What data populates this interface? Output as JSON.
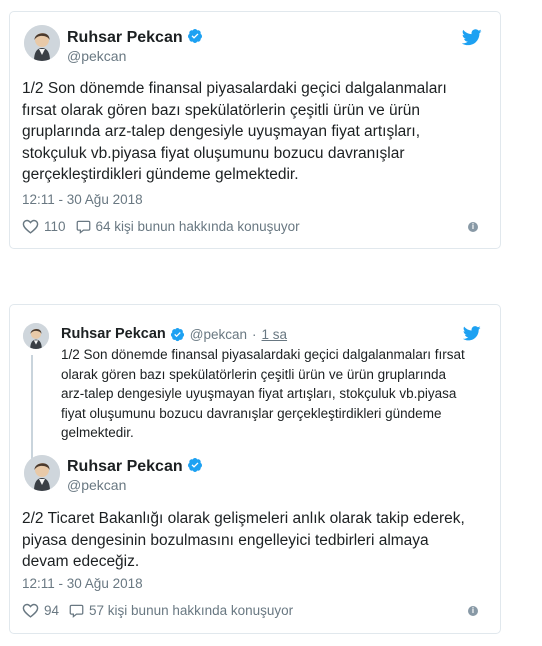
{
  "tweet1": {
    "author_name": "Ruhsar Pekcan",
    "handle": "@pekcan",
    "text": "1/2 Son dönemde finansal piyasalardaki geçici dalgalanmaları\nfırsat olarak gören bazı spekülatörlerin çeşitli ürün ve ürün\ngruplarında  arz-talep dengesiyle uyuşmayan  fiyat artışları,\nstokçuluk vb.piyasa fiyat oluşumunu bozucu davranışlar\ngerçekleştirdikleri gündeme gelmektedir.",
    "timestamp": "12:11 - 30 Ağu 2018",
    "likes": "110",
    "conversation": "64 kişi bunun hakkında konuşuyor"
  },
  "tweet2": {
    "quoted": {
      "author_name": "Ruhsar Pekcan",
      "handle": "@pekcan",
      "separator": "·",
      "time_ago": "1 sa",
      "text": "1/2 Son dönemde finansal piyasalardaki geçici dalgalanmaları fırsat\nolarak gören bazı spekülatörlerin çeşitli ürün ve ürün gruplarında\narz-talep dengesiyle uyuşmayan  fiyat artışları, stokçuluk vb.piyasa\nfiyat oluşumunu bozucu davranışlar gerçekleştirdikleri gündeme\ngelmektedir."
    },
    "author_name": "Ruhsar Pekcan",
    "handle": "@pekcan",
    "text": "2/2 Ticaret Bakanlığı olarak gelişmeleri anlık olarak takip ederek,\npiyasa dengesinin bozulmasını engelleyici tedbirleri almaya\ndevam edeceğiz.",
    "timestamp": "12:11 - 30 Ağu 2018",
    "likes": "94",
    "conversation": "57 kişi bunun hakkında konuşuyor"
  },
  "colors": {
    "twitter_blue": "#1da1f2",
    "verified_blue": "#1da1f2",
    "secondary_text": "#697882",
    "border": "#e1e8ed"
  },
  "icons": {
    "verified": "verified-badge-icon",
    "bird": "twitter-bird-icon",
    "like": "heart-icon",
    "reply": "speech-bubble-icon",
    "info": "info-icon"
  }
}
